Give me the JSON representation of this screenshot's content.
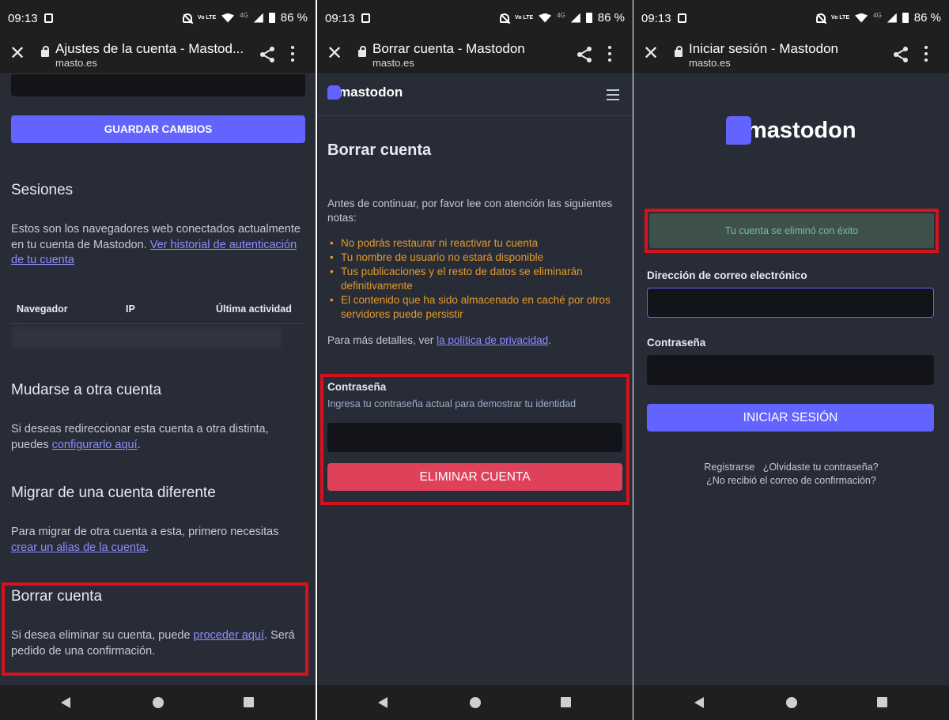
{
  "status_bar": {
    "time": "09:13",
    "battery": "86 %",
    "volte": "Vo LTE",
    "network": "4G"
  },
  "panels": [
    {
      "url_title": "Ajustes de la cuenta - Mastod...",
      "domain": "masto.es",
      "save_button": "GUARDAR CAMBIOS",
      "sessions": {
        "heading": "Sesiones",
        "text": "Estos son los navegadores web conectados actualmente en tu cuenta de Mastodon.",
        "link": "Ver historial de autenticación de tu cuenta",
        "columns": [
          "Navegador",
          "IP",
          "Última actividad"
        ]
      },
      "move": {
        "heading": "Mudarse a otra cuenta",
        "text": "Si deseas redireccionar esta cuenta a otra distinta, puedes",
        "link": "configurarlo aquí",
        "suffix": "."
      },
      "migrate": {
        "heading": "Migrar de una cuenta diferente",
        "text": "Para migrar de otra cuenta a esta, primero necesitas",
        "link": "crear un alias de la cuenta",
        "suffix": "."
      },
      "delete": {
        "heading": "Borrar cuenta",
        "text": "Si desea eliminar su cuenta, puede",
        "link": "proceder aquí",
        "suffix": ". Será pedido de una confirmación."
      }
    },
    {
      "url_title": "Borrar cuenta - Mastodon",
      "domain": "masto.es",
      "logo": "mastodon",
      "heading": "Borrar cuenta",
      "intro": "Antes de continuar, por favor lee con atención las siguientes notas:",
      "warnings": [
        "No podrás restaurar ni reactivar tu cuenta",
        "Tu nombre de usuario no estará disponible",
        "Tus publicaciones y el resto de datos se eliminarán definitivamente",
        "El contenido que ha sido almacenado en caché por otros servidores puede persistir"
      ],
      "details_prefix": "Para más detalles, ver",
      "details_link": "la política de privacidad",
      "details_suffix": ".",
      "password_label": "Contraseña",
      "password_hint": "Ingresa tu contraseña actual para demostrar tu identidad",
      "delete_button": "ELIMINAR CUENTA"
    },
    {
      "url_title": "Iniciar sesión - Mastodon",
      "domain": "masto.es",
      "logo": "mastodon",
      "success": "Tu cuenta se eliminó con éxito",
      "email_label": "Dirección de correo electrónico",
      "password_label": "Contraseña",
      "login_button": "INICIAR SESIÓN",
      "links": [
        "Registrarse",
        "¿Olvidaste tu contraseña?",
        "¿No recibió el correo de confirmación?"
      ]
    }
  ],
  "colors": {
    "accent": "#6364ff",
    "danger": "#df405a",
    "highlight": "#d7121c",
    "warning": "#e49a2a",
    "success_bg": "#3d5049",
    "success_text": "#79bd9a"
  }
}
